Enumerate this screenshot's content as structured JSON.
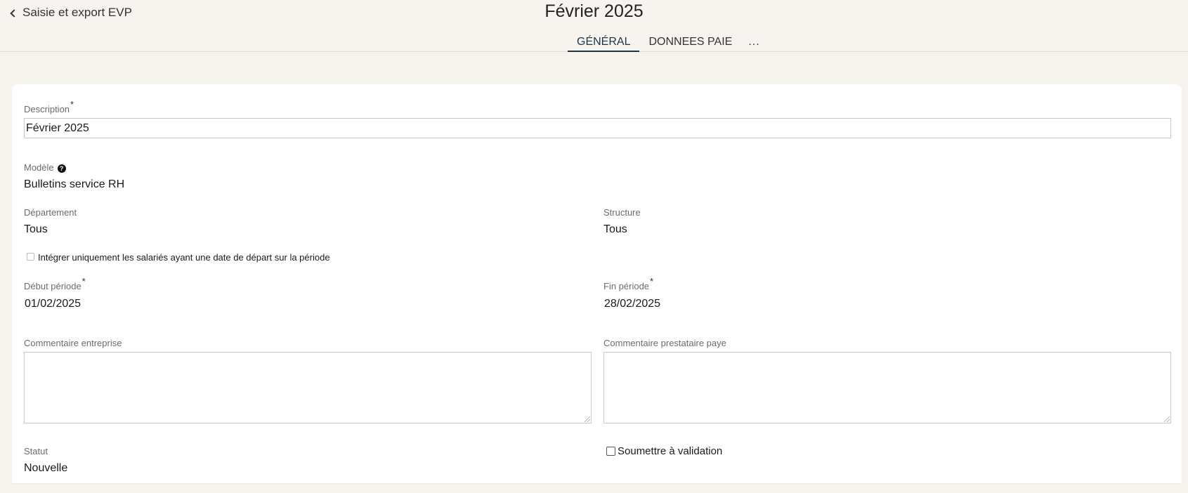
{
  "header": {
    "back_label": "Saisie et export EVP",
    "title": "Février 2025"
  },
  "tabs": [
    {
      "label": "GÉNÉRAL",
      "active": true
    },
    {
      "label": "DONNEES PAIE",
      "active": false
    },
    {
      "label": "...",
      "active": false
    }
  ],
  "form": {
    "description": {
      "label": "Description",
      "required_mark": "*",
      "value": "Février 2025"
    },
    "modele": {
      "label": "Modèle",
      "help_icon": "?",
      "value": "Bulletins service RH"
    },
    "departement": {
      "label": "Département",
      "value": "Tous"
    },
    "structure": {
      "label": "Structure",
      "value": "Tous"
    },
    "integrer_checkbox": {
      "label": "Intégrer uniquement les salariés ayant une date de départ sur la période",
      "checked": false
    },
    "debut_periode": {
      "label": "Début période",
      "required_mark": "*",
      "value": "01/02/2025"
    },
    "fin_periode": {
      "label": "Fin période",
      "required_mark": "*",
      "value": "28/02/2025"
    },
    "commentaire_entreprise": {
      "label": "Commentaire entreprise",
      "value": ""
    },
    "commentaire_prestataire": {
      "label": "Commentaire prestataire paye",
      "value": ""
    },
    "statut": {
      "label": "Statut",
      "value": "Nouvelle"
    },
    "soumettre_checkbox": {
      "label": "Soumettre à validation",
      "checked": false
    }
  },
  "colors": {
    "page_background": "#f7f4ef",
    "card_background": "#ffffff",
    "active_tab": "#1f3447"
  },
  "icons": {
    "back": "chevron-left-icon",
    "help": "question-circle-icon"
  }
}
